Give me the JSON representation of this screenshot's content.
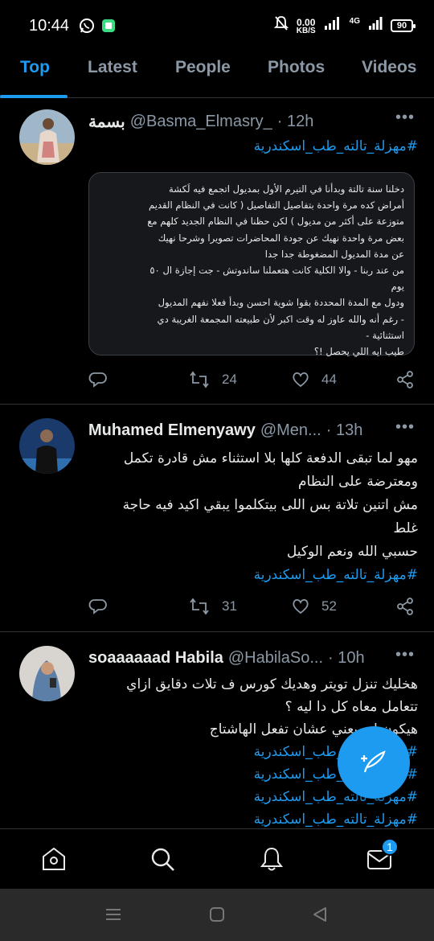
{
  "status_bar": {
    "time": "10:44",
    "net_speed": "0.00",
    "net_unit": "KB/S",
    "network": "4G",
    "battery": "90"
  },
  "tabs": [
    {
      "label": "Top",
      "active": true
    },
    {
      "label": "Latest"
    },
    {
      "label": "People"
    },
    {
      "label": "Photos"
    },
    {
      "label": "Videos"
    }
  ],
  "tweets": [
    {
      "name": "بسمة",
      "handle": "@Basma_Elmasry_",
      "time": "· 12h",
      "more": "•••",
      "body_hashtag": "#مهزلة_تالته_طب_اسكندرية",
      "card_lines": [
        "دخلنا سنة تالتة وبدأنا في التيرم الأول بمديول اتجمع فيه لَكشة",
        "أمراض كده مرة واحدة بتفاصيل التفاصيل ( كانت في النظام القديم",
        "متوزعة على أكثر من مديول ) لكن حظنا في النظام الجديد كلهم مع",
        "بعض مرة واحدة نهيك عن جودة المحاضرات تصويرا وشرحا نهيك",
        "عن مدة المديول المضغوطة جدا جدا",
        "من عند ربنا - والا الكلية كانت هتعملنا ساندوتش - جت إجازة ال ٥٠",
        "يوم",
        "ودول مع المدة المحددة بقوا شوية احسن وبدأ فعلا نفهم المديول",
        "- رغم أنه والله عاوز له وقت اكبر لأن طبيعته المجمعة الغريبة دي",
        "استثنائية -",
        "طيب ايه اللي يحصل !؟"
      ],
      "retweets": "24",
      "likes": "44"
    },
    {
      "name": "Muhamed Elmenyawy",
      "handle": "@Men...",
      "time": "· 13h",
      "more": "•••",
      "body_lines": [
        "مهو لما تبقى الدفعة كلها بلا استثناء مش قادرة تكمل",
        "ومعترضة على النظام",
        "مش اتنين تلاتة بس اللى بيتكلموا يبقي اكيد فيه حاجة",
        "غلط",
        "حسبي الله ونعم الوكيل"
      ],
      "body_hashtag": "#مهزلة_تالته_طب_اسكندرية",
      "retweets": "31",
      "likes": "52"
    },
    {
      "name": "soaaaaaad Habila",
      "handle": "@HabilaSo...",
      "time": "· 10h",
      "more": "•••",
      "body_lines": [
        "هخليك تنزل تويتر وهديك كورس ف تلات دقايق ازاي",
        "تتعامل معاه كل دا ليه ؟",
        "هيكون ليه يعني عشان تفعل الهاشتاج"
      ],
      "hashtags": [
        "#مهزلة_تالته_طب_اسكندرية",
        "#مهزلة_تالته_طب_اسكندرية",
        "#مهزلة_تالته_طب_اسكندرية",
        "#مهزلة_تالته_طب_اسكندرية"
      ]
    }
  ],
  "nav": {
    "messages_badge": "1"
  },
  "icons": {
    "home": "home-icon",
    "search": "search-icon",
    "notifications": "bell-icon",
    "messages": "mail-icon",
    "compose": "compose-icon"
  },
  "colors": {
    "accent": "#1d9bf0",
    "background": "#000000",
    "muted": "#8b98a5"
  }
}
